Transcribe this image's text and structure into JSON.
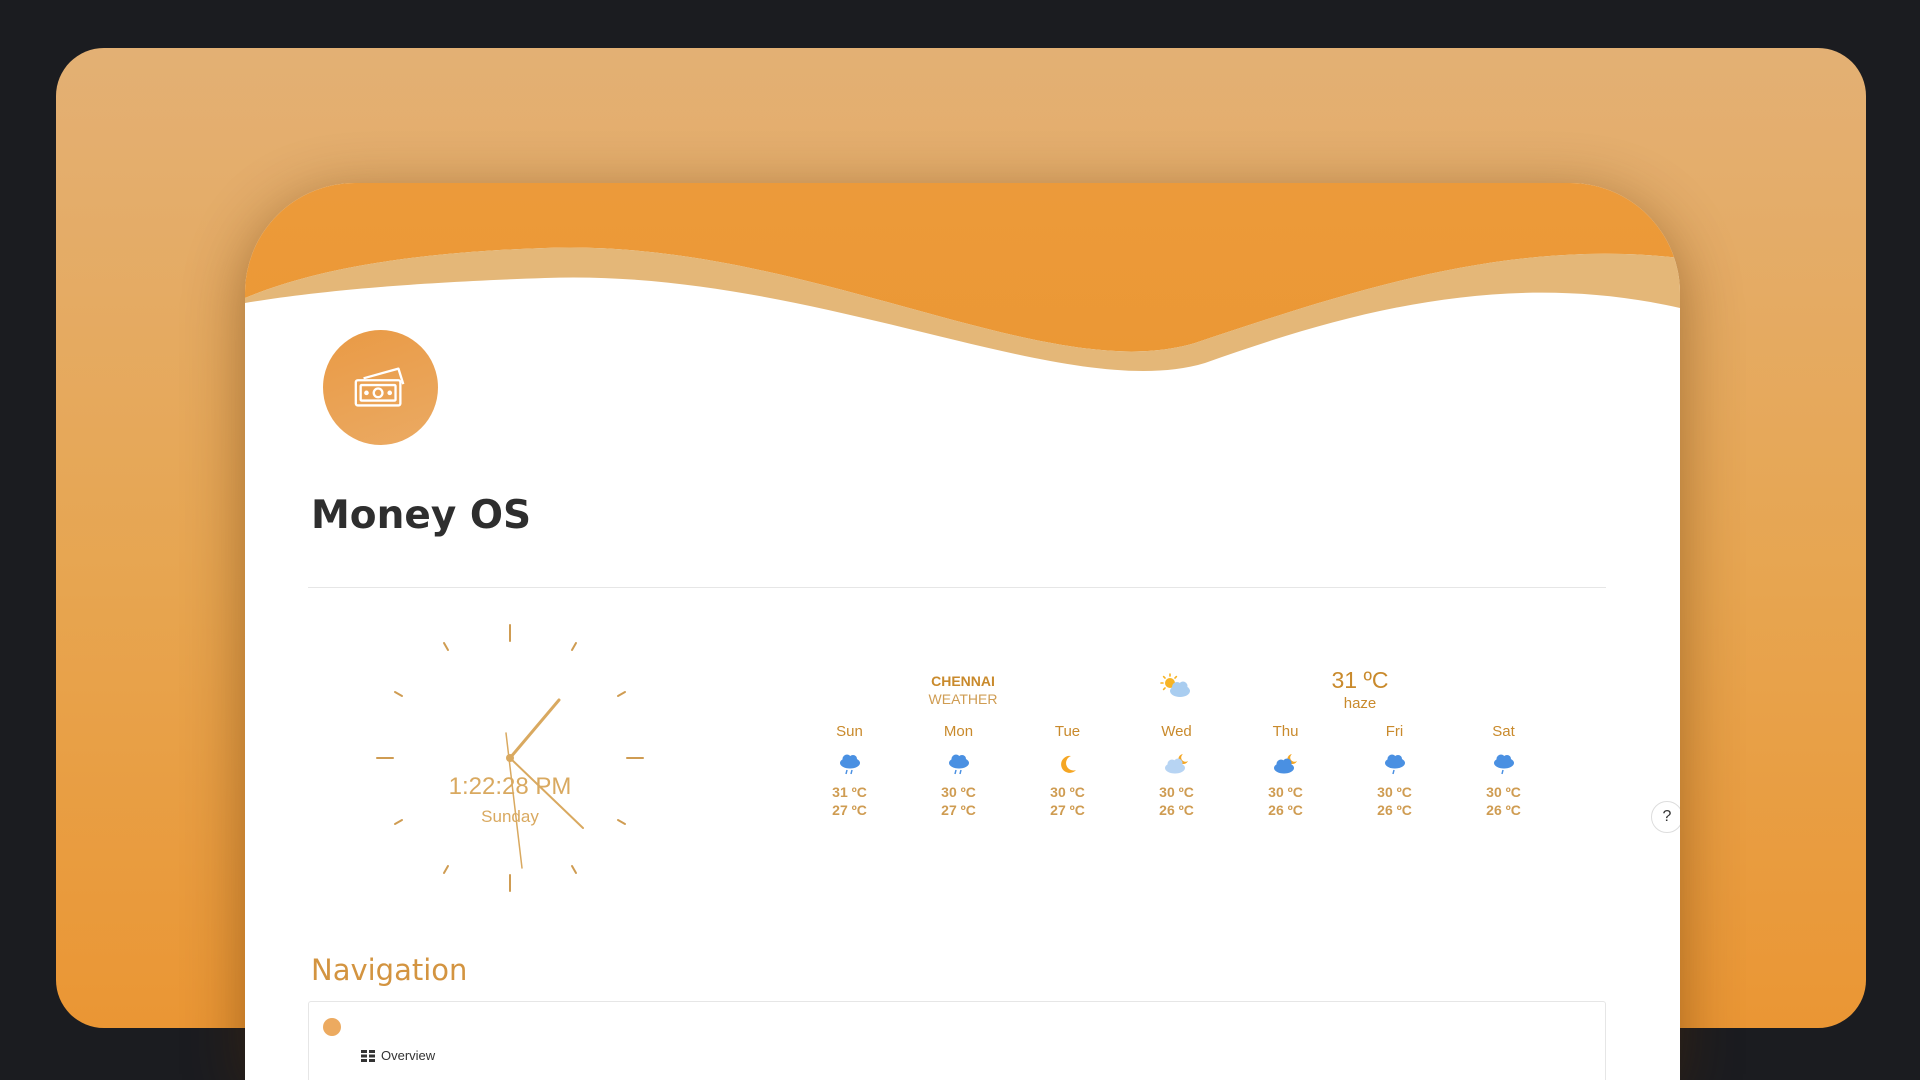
{
  "page": {
    "title": "Money OS",
    "icon": "money-icon"
  },
  "clock": {
    "time": "1:22:28 PM",
    "day": "Sunday"
  },
  "weather": {
    "city": "CHENNAI",
    "label": "WEATHER",
    "current_temp": "31 ºC",
    "current_desc": "haze",
    "current_icon": "sun-cloud-icon",
    "days": [
      {
        "name": "Sun",
        "icon": "rain-cloud-icon",
        "hi": "31 ºC",
        "lo": "27 ºC"
      },
      {
        "name": "Mon",
        "icon": "rain-cloud-icon",
        "hi": "30 ºC",
        "lo": "27 ºC"
      },
      {
        "name": "Tue",
        "icon": "moon-icon",
        "hi": "30 ºC",
        "lo": "27 ºC"
      },
      {
        "name": "Wed",
        "icon": "cloud-moon-icon",
        "hi": "30 ºC",
        "lo": "26 ºC"
      },
      {
        "name": "Thu",
        "icon": "cloud-moon-icon",
        "hi": "30 ºC",
        "lo": "26 ºC"
      },
      {
        "name": "Fri",
        "icon": "rain-cloud-icon",
        "hi": "30 ºC",
        "lo": "26 ºC"
      },
      {
        "name": "Sat",
        "icon": "rain-cloud-icon",
        "hi": "30 ºC",
        "lo": "26 ºC"
      }
    ]
  },
  "help": {
    "label": "?"
  },
  "navigation": {
    "heading": "Navigation",
    "items": [
      {
        "label": "Overview",
        "icon": "table-icon"
      }
    ]
  },
  "colors": {
    "accent": "#e99a3a",
    "weather_text": "#c98a2c",
    "clock": "#d9a960",
    "backdrop": "#e7a550"
  }
}
